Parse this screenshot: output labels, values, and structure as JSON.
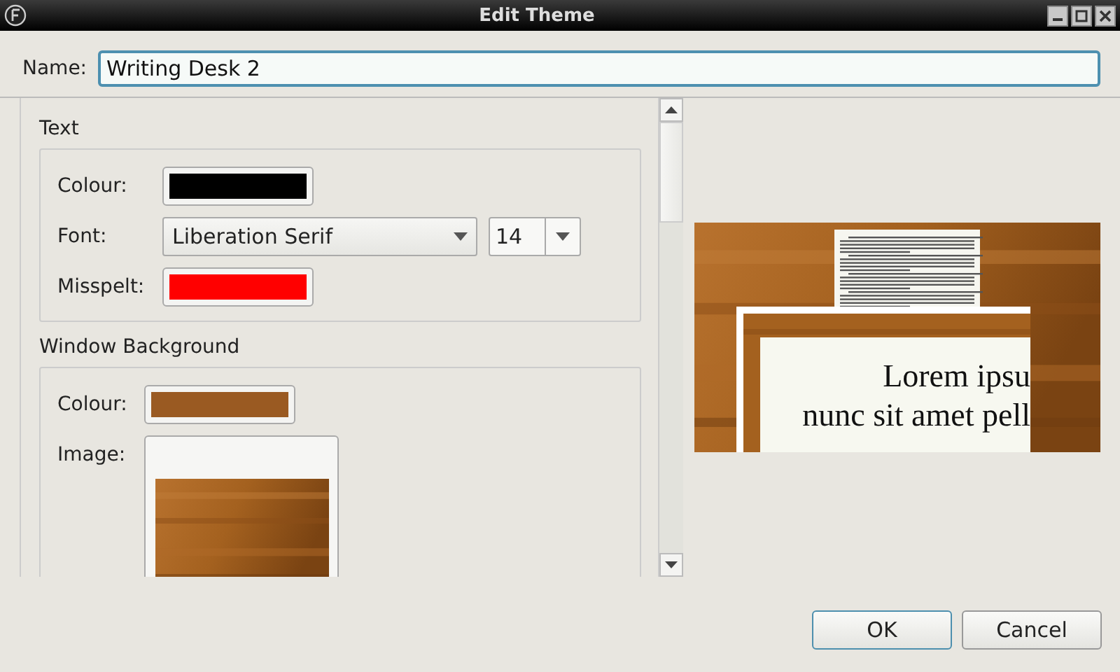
{
  "window": {
    "title": "Edit Theme"
  },
  "name_field": {
    "label": "Name:",
    "value": "Writing Desk 2"
  },
  "sections": [
    {
      "title": "Text",
      "rows": [
        {
          "kind": "colour",
          "label": "Colour:",
          "color": "#000000"
        },
        {
          "kind": "font",
          "label": "Font:",
          "value": "Liberation Serif",
          "size": "14"
        },
        {
          "kind": "colour",
          "label": "Misspelt:",
          "color": "#ff0000"
        }
      ]
    },
    {
      "title": "Window Background",
      "rows": [
        {
          "kind": "colour",
          "label": "Colour:",
          "color": "#9a5a22"
        },
        {
          "label": "Image:"
        }
      ]
    }
  ],
  "preview": {
    "lines": [
      "Lorem ipsu",
      "nunc sit amet pell"
    ]
  },
  "buttons": [
    {
      "label": "OK",
      "default": true
    },
    {
      "label": "Cancel",
      "default": false
    }
  ]
}
